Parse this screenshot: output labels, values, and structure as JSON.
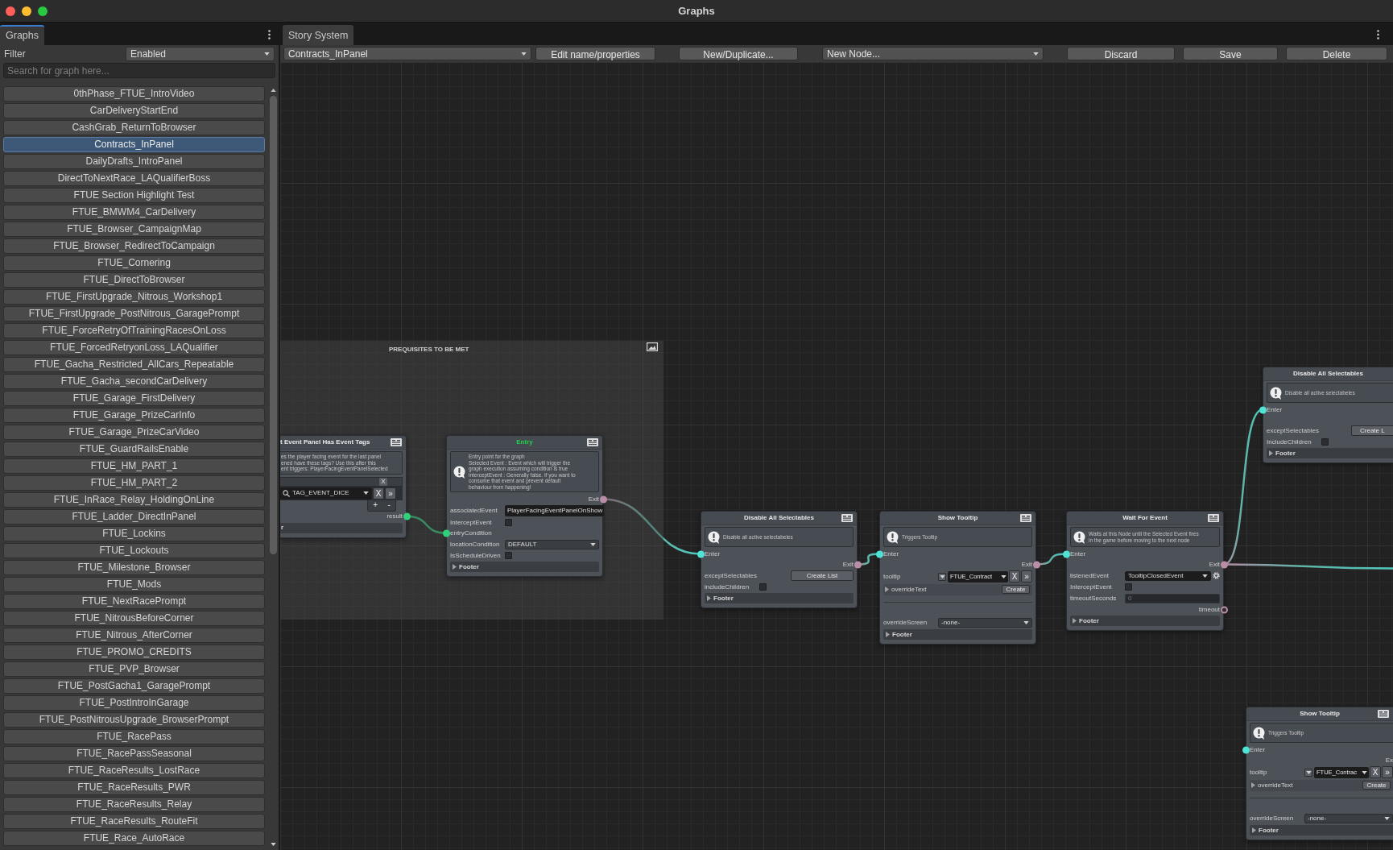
{
  "window": {
    "title": "Graphs"
  },
  "graphs_panel": {
    "tab": {
      "label": "Graphs",
      "focused": true
    },
    "filter": {
      "label": "Filter",
      "value": "Enabled"
    },
    "search": {
      "placeholder": "Search for graph here..."
    },
    "items": [
      {
        "label": "0thPhase_FTUE_IntroVideo",
        "selected": false
      },
      {
        "label": "CarDeliveryStartEnd",
        "selected": false
      },
      {
        "label": "CashGrab_ReturnToBrowser",
        "selected": false
      },
      {
        "label": "Contracts_InPanel",
        "selected": true
      },
      {
        "label": "DailyDrafts_IntroPanel",
        "selected": false
      },
      {
        "label": "DirectToNextRace_LAQualifierBoss",
        "selected": false
      },
      {
        "label": "FTUE Section Highlight Test",
        "selected": false
      },
      {
        "label": "FTUE_BMWM4_CarDelivery",
        "selected": false
      },
      {
        "label": "FTUE_Browser_CampaignMap",
        "selected": false
      },
      {
        "label": "FTUE_Browser_RedirectToCampaign",
        "selected": false
      },
      {
        "label": "FTUE_Cornering",
        "selected": false
      },
      {
        "label": "FTUE_DirectToBrowser",
        "selected": false
      },
      {
        "label": "FTUE_FirstUpgrade_Nitrous_Workshop1",
        "selected": false
      },
      {
        "label": "FTUE_FirstUpgrade_PostNitrous_GaragePrompt",
        "selected": false
      },
      {
        "label": "FTUE_ForceRetryOfTrainingRacesOnLoss",
        "selected": false
      },
      {
        "label": "FTUE_ForcedRetryonLoss_LAQualifier",
        "selected": false
      },
      {
        "label": "FTUE_Gacha_Restricted_AllCars_Repeatable",
        "selected": false
      },
      {
        "label": "FTUE_Gacha_secondCarDelivery",
        "selected": false
      },
      {
        "label": "FTUE_Garage_FirstDelivery",
        "selected": false
      },
      {
        "label": "FTUE_Garage_PrizeCarInfo",
        "selected": false
      },
      {
        "label": "FTUE_Garage_PrizeCarVideo",
        "selected": false
      },
      {
        "label": "FTUE_GuardRailsEnable",
        "selected": false
      },
      {
        "label": "FTUE_HM_PART_1",
        "selected": false
      },
      {
        "label": "FTUE_HM_PART_2",
        "selected": false
      },
      {
        "label": "FTUE_InRace_Relay_HoldingOnLine",
        "selected": false
      },
      {
        "label": "FTUE_Ladder_DirectInPanel",
        "selected": false
      },
      {
        "label": "FTUE_Lockins",
        "selected": false
      },
      {
        "label": "FTUE_Lockouts",
        "selected": false
      },
      {
        "label": "FTUE_Milestone_Browser",
        "selected": false
      },
      {
        "label": "FTUE_Mods",
        "selected": false
      },
      {
        "label": "FTUE_NextRacePrompt",
        "selected": false
      },
      {
        "label": "FTUE_NitrousBeforeCorner",
        "selected": false
      },
      {
        "label": "FTUE_Nitrous_AfterCorner",
        "selected": false
      },
      {
        "label": "FTUE_PROMO_CREDITS",
        "selected": false
      },
      {
        "label": "FTUE_PVP_Browser",
        "selected": false
      },
      {
        "label": "FTUE_PostGacha1_GaragePrompt",
        "selected": false
      },
      {
        "label": "FTUE_PostIntroInGarage",
        "selected": false
      },
      {
        "label": "FTUE_PostNitrousUpgrade_BrowserPrompt",
        "selected": false
      },
      {
        "label": "FTUE_RacePass",
        "selected": false
      },
      {
        "label": "FTUE_RacePassSeasonal",
        "selected": false
      },
      {
        "label": "FTUE_RaceResults_LostRace",
        "selected": false
      },
      {
        "label": "FTUE_RaceResults_PWR",
        "selected": false
      },
      {
        "label": "FTUE_RaceResults_Relay",
        "selected": false
      },
      {
        "label": "FTUE_RaceResults_RouteFit",
        "selected": false
      },
      {
        "label": "FTUE_Race_AutoRace",
        "selected": false
      }
    ]
  },
  "editor_panel": {
    "tab": {
      "label": "Story System",
      "focused": false
    },
    "toolbar": [
      {
        "kind": "dropdown",
        "label": "Contracts_InPanel"
      },
      {
        "kind": "button",
        "label": "Edit name/properties"
      },
      {
        "kind": "button",
        "label": "New/Duplicate..."
      },
      {
        "kind": "dropdown",
        "label": "New Node..."
      },
      {
        "kind": "button",
        "label": "Discard"
      },
      {
        "kind": "button",
        "label": "Save"
      },
      {
        "kind": "button",
        "label": "Delete"
      }
    ]
  },
  "graph": {
    "groups": [
      {
        "title": "PREQUISITES TO BE MET"
      }
    ],
    "nodes": [
      {
        "kind": "condition",
        "title": "t Event Panel Has Event Tags",
        "description": "es the player facing event for the last panel\nened have these tags? Use this after this\nent triggers: PlayerFacingEventPanelSelected",
        "rows": [
          {
            "kind": "tag_list",
            "clear_label": "X",
            "tags": [
              {
                "value": "TAG_EVENT_DICE",
                "buttons": [
                  "X",
                  "»"
                ]
              }
            ],
            "add_label": "+",
            "remove_label": "-"
          },
          {
            "kind": "output",
            "label": "result",
            "color": "#2fd27a",
            "connected": true
          }
        ],
        "footer": {
          "label": "r"
        }
      },
      {
        "kind": "entry",
        "title": "Entry",
        "description": "Entry point for the graph\nSelected Event : Event which will trigger the\ngraph execution assuming condition is true\ninterceptEvent : Generally false. If you want to\nconsume that event and prevent default\nbehaviour from happening!",
        "rows": [
          {
            "kind": "output",
            "label": "Exit",
            "color": "#b98ea6",
            "connected": true
          },
          {
            "kind": "text",
            "label": "associatedEvent",
            "value": "PlayerFacingEventPanelOnShow"
          },
          {
            "kind": "checkbox",
            "label": "InterceptEvent",
            "checked": false
          },
          {
            "kind": "input",
            "label": "entryCondition",
            "color": "#2fd27a",
            "connected": true
          },
          {
            "kind": "dropdown",
            "label": "locationCondition",
            "value": "DEFAULT"
          },
          {
            "kind": "checkbox",
            "label": "IsScheduleDriven",
            "checked": false
          }
        ],
        "footer": {
          "label": "Footer",
          "expanded": false
        }
      },
      {
        "kind": "action",
        "title": "Disable All Selectables",
        "description": "Disable all active selectabeles",
        "rows": [
          {
            "kind": "input",
            "label": "Enter",
            "color": "#4fe3d4",
            "connected": true
          },
          {
            "kind": "output",
            "label": "Exit",
            "color": "#b98ea6",
            "connected": true
          },
          {
            "kind": "button",
            "label": "exceptSelectables",
            "button": "Create List"
          },
          {
            "kind": "checkbox",
            "label": "includeChildren",
            "checked": false
          }
        ],
        "footer": {
          "label": "Footer",
          "expanded": false
        }
      },
      {
        "kind": "action",
        "title": "Show Tooltip",
        "description": "Triggers Tooltip",
        "rows": [
          {
            "kind": "input",
            "label": "Enter",
            "color": "#4fe3d4",
            "connected": true
          },
          {
            "kind": "output",
            "label": "Exit",
            "color": "#b98ea6",
            "connected": true
          },
          {
            "kind": "object",
            "label": "tooltip",
            "value": "FTUE_Contract",
            "buttons": [
              "X",
              "»"
            ]
          },
          {
            "kind": "foldout",
            "label": "overrideText",
            "expanded": false,
            "button": "Create"
          },
          {
            "kind": "separator"
          },
          {
            "kind": "dropdown",
            "label": "overrideScreen",
            "value": "-none-"
          }
        ],
        "footer": {
          "label": "Footer",
          "expanded": false
        }
      },
      {
        "kind": "action",
        "title": "Wait For Event",
        "description": "Waits at this Node until the Selected Event fires\nin the game before moving to the next node",
        "rows": [
          {
            "kind": "input",
            "label": "Enter",
            "color": "#4fe3d4",
            "connected": true
          },
          {
            "kind": "output",
            "label": "Exit",
            "color": "#b98ea6",
            "connected": true
          },
          {
            "kind": "event_dropdown",
            "label": "listenedEvent",
            "value": "TooltipClosedEvent"
          },
          {
            "kind": "checkbox",
            "label": "InterceptEvent",
            "checked": false
          },
          {
            "kind": "number",
            "label": "timeoutSeconds",
            "value": "0",
            "disabled": true
          },
          {
            "kind": "output",
            "label": "timeout",
            "color": "#b98ea6",
            "connected": false
          }
        ],
        "footer": {
          "label": "Footer",
          "expanded": false
        }
      },
      {
        "kind": "action",
        "title": "Disable All Selectables",
        "description": "Disable all active selectabeles",
        "rows": [
          {
            "kind": "input",
            "label": "Enter",
            "color": "#4fe3d4",
            "connected": true
          },
          {
            "kind": "button",
            "label": "exceptSelectables",
            "button": "Create L"
          },
          {
            "kind": "checkbox",
            "label": "IncludeChildren",
            "checked": false
          }
        ],
        "footer": {
          "label": "Footer",
          "expanded": false
        }
      },
      {
        "kind": "action",
        "title": "Show Tooltip",
        "description": "Triggers Tooltip",
        "rows": [
          {
            "kind": "input",
            "label": "Enter",
            "color": "#4fe3d4",
            "connected": true
          },
          {
            "kind": "output",
            "label": "Ex"
          },
          {
            "kind": "object",
            "label": "tooltip",
            "value": "FTUE_Contrac",
            "buttons": [
              "X",
              "»"
            ]
          },
          {
            "kind": "foldout",
            "label": "overrideText",
            "expanded": false,
            "button": "Create"
          },
          {
            "kind": "separator"
          },
          {
            "kind": "dropdown",
            "label": "overrideScreen",
            "value": "-none-"
          }
        ],
        "footer": {
          "label": "Footer",
          "expanded": false
        }
      }
    ]
  }
}
